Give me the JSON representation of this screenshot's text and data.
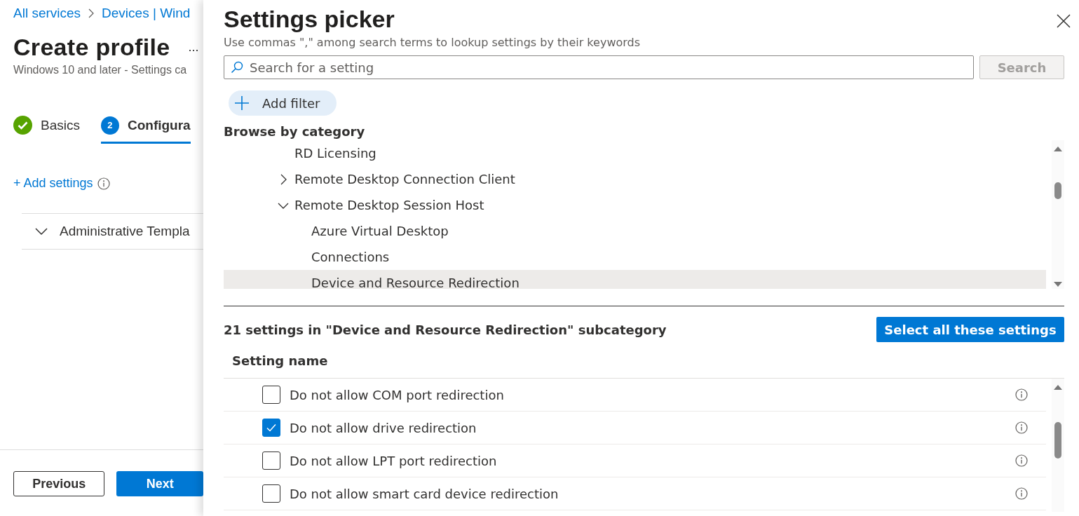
{
  "breadcrumb": [
    {
      "label": "All services"
    },
    {
      "label": "Devices | Wind"
    }
  ],
  "page": {
    "title": "Create profile",
    "more": "...",
    "subtitle": "Windows 10 and later - Settings ca"
  },
  "steps": [
    {
      "label": "Basics",
      "kind": "done",
      "selected": false
    },
    {
      "label": "Configura",
      "number": "2",
      "kind": "current",
      "selected": true
    }
  ],
  "add_settings": {
    "label": "+ Add settings"
  },
  "sections": [
    {
      "label": "Administrative Templa",
      "expanded": true
    }
  ],
  "footer": {
    "buttons": [
      {
        "label": "Previous",
        "kind": "secondary"
      },
      {
        "label": "Next",
        "kind": "primary"
      }
    ]
  },
  "panel": {
    "title": "Settings picker",
    "hint": "Use commas \",\" among search terms to lookup settings by their keywords",
    "search": {
      "placeholder": "Search for a setting",
      "button": "Search",
      "disabled": true
    },
    "add_filter": "Add filter",
    "browse_heading": "Browse by category",
    "tree": [
      {
        "label": "RD Licensing",
        "selected": false
      },
      {
        "label": "Remote Desktop Connection Client",
        "expanded": false,
        "selected": false
      },
      {
        "label": "Remote Desktop Session Host",
        "expanded": true,
        "selected": false,
        "children": [
          {
            "label": "Azure Virtual Desktop",
            "selected": false
          },
          {
            "label": "Connections",
            "selected": false
          },
          {
            "label": "Device and Resource Redirection",
            "selected": true
          }
        ]
      }
    ],
    "results": {
      "summary": "21 settings in \"Device and Resource Redirection\" subcategory",
      "select_all": "Select all these settings",
      "column": "Setting name",
      "rows": [
        {
          "name": "Do not allow COM port redirection",
          "checked": false
        },
        {
          "name": "Do not allow drive redirection",
          "checked": true
        },
        {
          "name": "Do not allow LPT port redirection",
          "checked": false
        },
        {
          "name": "Do not allow smart card device redirection",
          "checked": false
        }
      ]
    }
  }
}
